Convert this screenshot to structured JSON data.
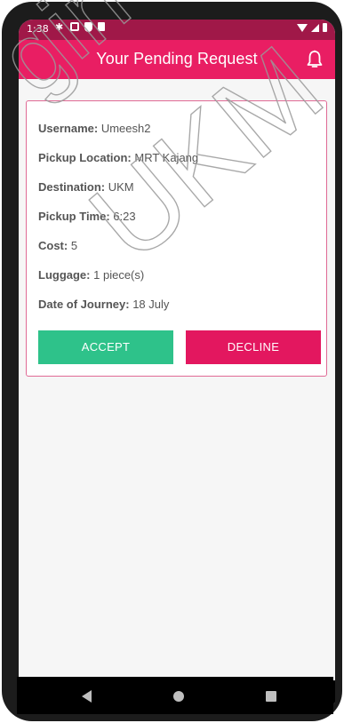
{
  "status_bar": {
    "time": "1:38"
  },
  "app_bar": {
    "title": "Your Pending Request",
    "action_icon": "bell-icon"
  },
  "request": {
    "fields": [
      {
        "label": "Username:",
        "value": "Umeesh2"
      },
      {
        "label": "Pickup Location:",
        "value": "MRT Kajang"
      },
      {
        "label": "Destination:",
        "value": "UKM"
      },
      {
        "label": "Pickup Time:",
        "value": "6:23"
      },
      {
        "label": "Cost:",
        "value": "5"
      },
      {
        "label": "Luggage:",
        "value": "1 piece(s)"
      },
      {
        "label": "Date of Journey:",
        "value": "18 July"
      }
    ],
    "accept_label": "ACCEPT",
    "decline_label": "DECLINE"
  },
  "watermark": {
    "left_text": "gin",
    "right_text": "UKM"
  },
  "colors": {
    "app_bar": "#e91e63",
    "status_bar": "#a01848",
    "accept": "#2ec28a",
    "decline": "#e3175f",
    "card_border": "#e06a95"
  }
}
